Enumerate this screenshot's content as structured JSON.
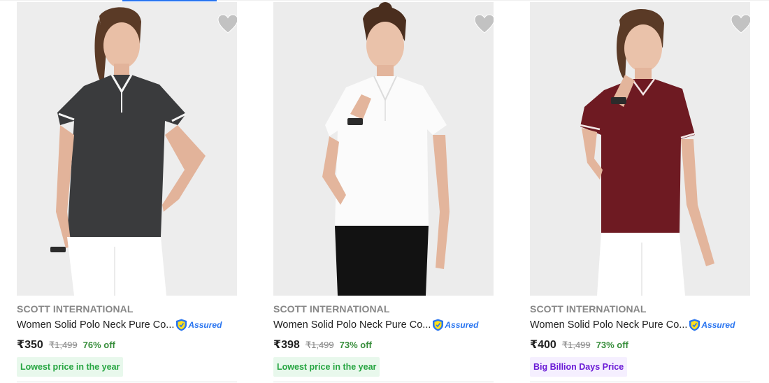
{
  "products": [
    {
      "brand": "SCOTT INTERNATIONAL",
      "title": "Women Solid Polo Neck Pure Co...",
      "assured_label": "Assured",
      "price": "₹350",
      "mrp": "₹1,499",
      "discount": "76% off",
      "badge": "Lowest price in the year",
      "shirt_color": "#3a3b3d",
      "pants_color": "#ffffff"
    },
    {
      "brand": "SCOTT INTERNATIONAL",
      "title": "Women Solid Polo Neck Pure Co...",
      "assured_label": "Assured",
      "price": "₹398",
      "mrp": "₹1,499",
      "discount": "73% off",
      "badge": "Lowest price in the year",
      "shirt_color": "#fbfbfb",
      "pants_color": "#121212"
    },
    {
      "brand": "SCOTT INTERNATIONAL",
      "title": "Women Solid Polo Neck Pure Co...",
      "assured_label": "Assured",
      "price": "₹400",
      "mrp": "₹1,499",
      "discount": "73% off",
      "badge": "Big Billion Days Price",
      "shirt_color": "#6e1a22",
      "pants_color": "#ffffff"
    }
  ],
  "icons": {
    "wishlist": "heart-icon",
    "assured": "assured-shield-icon"
  },
  "colors": {
    "accent": "#2874f0",
    "discount_green": "#388e3c",
    "badge_green_text": "#26a541",
    "badge_purple_text": "#6a1ad6"
  }
}
